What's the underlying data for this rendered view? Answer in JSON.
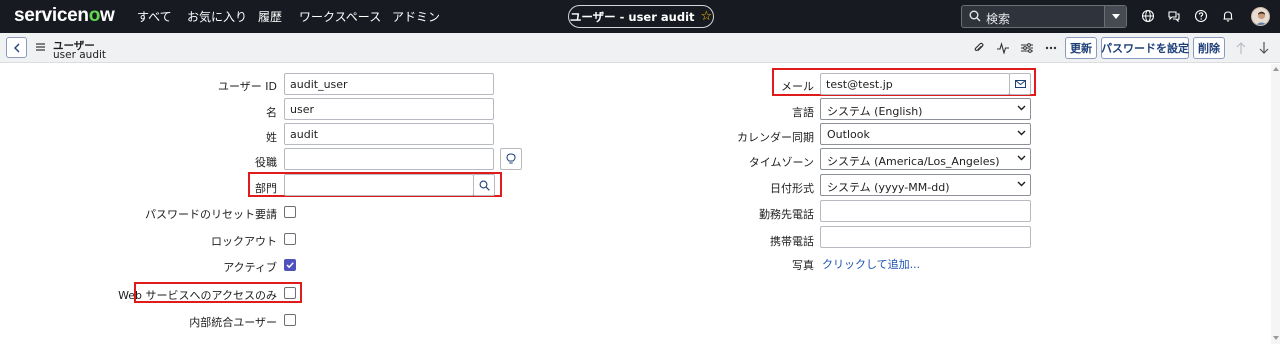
{
  "topnav": {
    "logo_main": "servicen",
    "logo_o": "o",
    "logo_end": "w",
    "menu": [
      "すべて",
      "お気に入り",
      "履歴",
      "ワークスペース",
      "アドミン"
    ],
    "record_title": "ユーザー - user audit",
    "search_label": "検索"
  },
  "header": {
    "record_type": "ユーザー",
    "record_name": "user audit",
    "buttons": {
      "update": "更新",
      "reset_password": "パスワードを設定",
      "delete": "削除"
    }
  },
  "form": {
    "left": {
      "user_id_label": "ユーザー ID",
      "user_id_value": "audit_user",
      "first_name_label": "名",
      "first_name_value": "user",
      "last_name_label": "姓",
      "last_name_value": "audit",
      "title_label": "役職",
      "title_value": "",
      "department_label": "部門",
      "department_value": "",
      "password_reset_label": "パスワードのリセット要請",
      "password_reset_checked": false,
      "locked_out_label": "ロックアウト",
      "locked_out_checked": false,
      "active_label": "アクティブ",
      "active_checked": true,
      "web_service_label": "Web サービスへのアクセスのみ",
      "web_service_checked": false,
      "internal_integration_label": "内部統合ユーザー",
      "internal_integration_checked": false
    },
    "right": {
      "email_label": "メール",
      "email_value": "test@test.jp",
      "language_label": "言語",
      "language_value": "システム (English)",
      "calendar_label": "カレンダー同期",
      "calendar_value": "Outlook",
      "timezone_label": "タイムゾーン",
      "timezone_value": "システム (America/Los_Angeles)",
      "date_format_label": "日付形式",
      "date_format_value": "システム (yyyy-MM-dd)",
      "business_phone_label": "勤務先電話",
      "business_phone_value": "",
      "mobile_phone_label": "携帯電話",
      "mobile_phone_value": "",
      "photo_label": "写真",
      "photo_link": "クリックして追加..."
    }
  },
  "colors": {
    "nav_bg": "#171a21",
    "accent_green": "#62d84e",
    "highlight_red": "#e01b1b",
    "checkbox_on": "#4f52bd",
    "link_blue": "#1c52b6"
  }
}
